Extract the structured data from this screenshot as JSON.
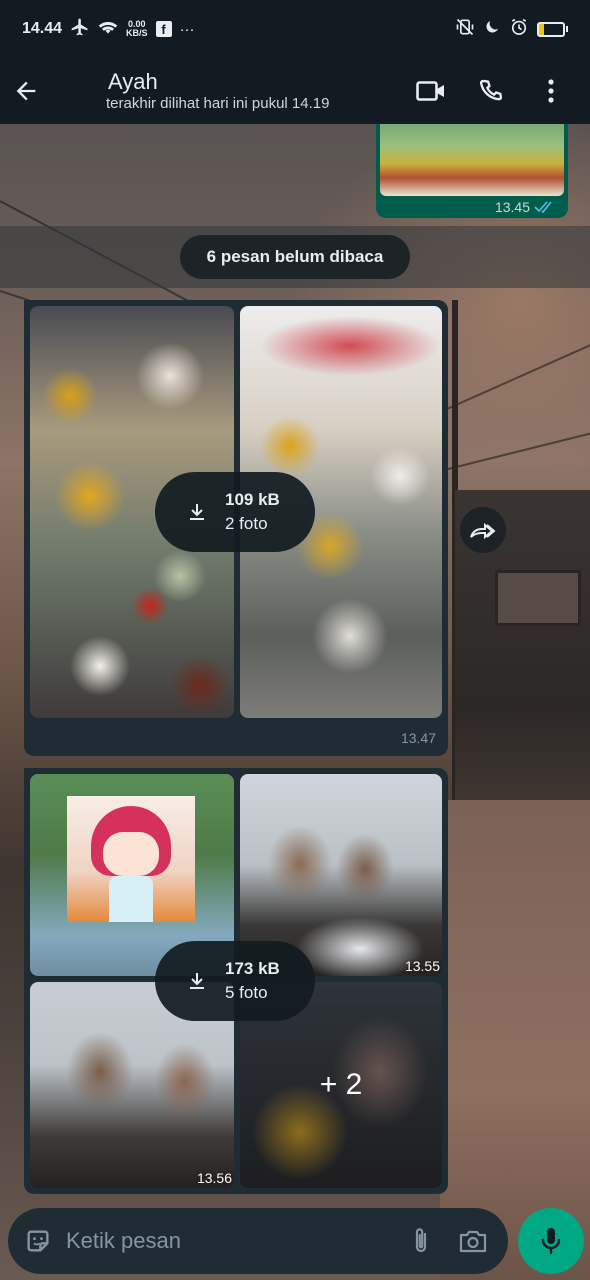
{
  "status_bar": {
    "time": "14.44",
    "net_speed_value": "0.00",
    "net_speed_unit": "KB/S",
    "facebook_glyph": "f",
    "more_indicator": "···",
    "battery_level": "19",
    "battery_fraction": 0.19,
    "icons": [
      "airplane-icon",
      "wifi-icon",
      "facebook-icon",
      "vibrate-icon",
      "moon-icon",
      "alarm-icon",
      "battery-icon"
    ]
  },
  "header": {
    "contact_name": "Ayah",
    "last_seen": "terakhir dilihat hari ini pukul 14.19",
    "icons": [
      "back-arrow-icon",
      "video-call-icon",
      "voice-call-icon",
      "more-vert-icon"
    ]
  },
  "chat": {
    "sent_message": {
      "time": "13.45",
      "status": "read"
    },
    "unread_banner": "6 pesan belum dibaca",
    "album1": {
      "size": "109 kB",
      "count": "2 foto",
      "time": "13.47"
    },
    "album2": {
      "size": "173 kB",
      "count": "5 foto",
      "tile_time_1": "13.55",
      "tile_time_2": "13.56",
      "more_count": "+ 2"
    }
  },
  "composer": {
    "placeholder": "Ketik pesan",
    "icons": [
      "sticker-icon",
      "attach-icon",
      "camera-icon",
      "mic-icon"
    ]
  },
  "colors": {
    "bar_bg": "#111b21",
    "bubble_bg": "#1f2c34",
    "sent_bg": "#005c4b",
    "accent": "#00a884",
    "read_ticks": "#53bdeb"
  }
}
